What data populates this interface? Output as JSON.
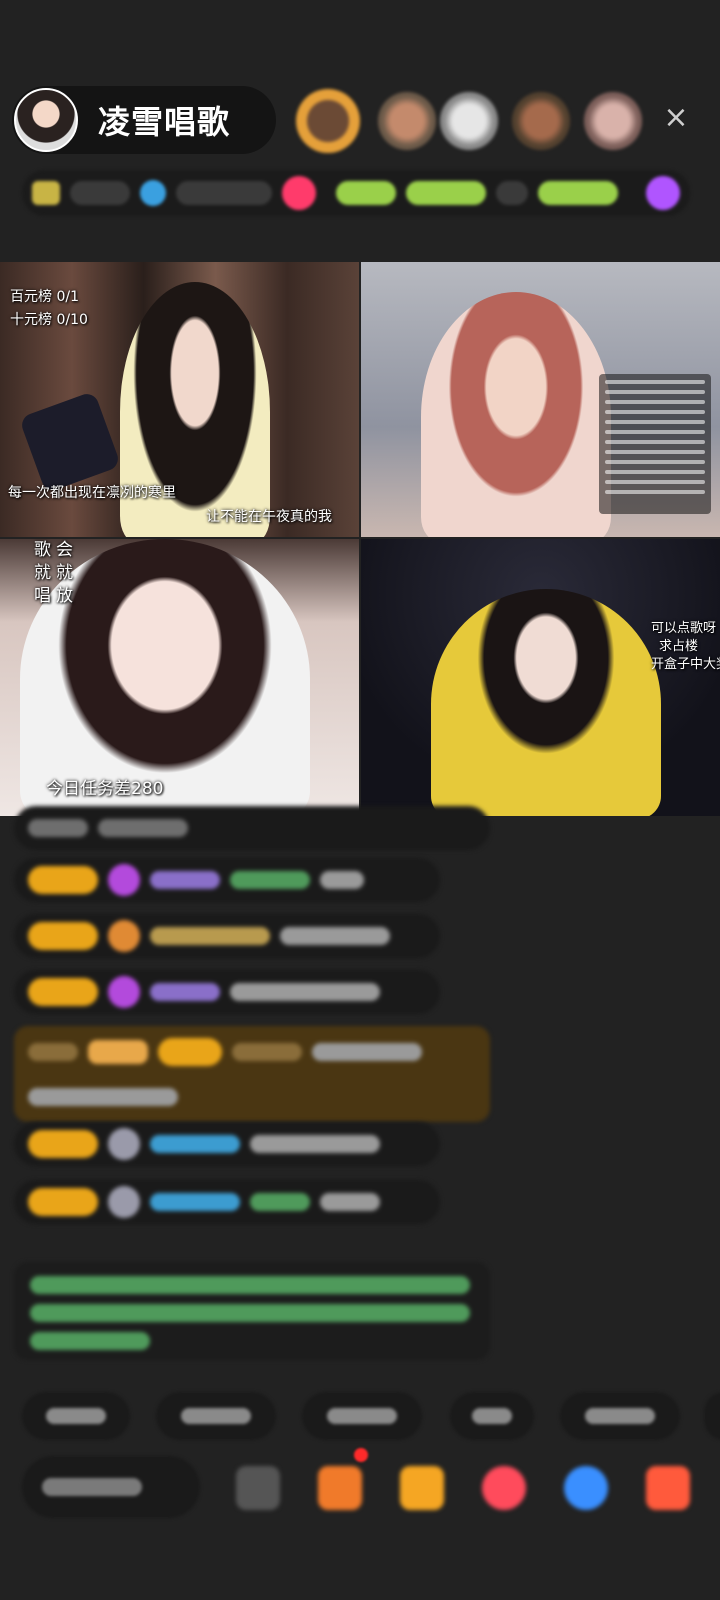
{
  "header": {
    "host_name": "凌雪唱歌",
    "close_icon": "×"
  },
  "video_tiles": {
    "tile1": {
      "rank_hundred": "百元榜 0/1",
      "rank_ten": "十元榜 0/10",
      "subtitle_1": "每一次都出现在凛冽的寒里",
      "subtitle_2": "让不能在午夜真的我"
    },
    "tile3": {
      "vertical_1": "歌就唱",
      "vertical_2": "会就放",
      "task_text": "今日任务差280"
    },
    "tile4": {
      "request_1": "可以点歌呀",
      "request_2": "求占楼",
      "request_3": "开盒子中大奖"
    }
  },
  "colors": {
    "badge_gold": "#e9a519",
    "gift_box": "#4a3612",
    "accent_red": "#ff2a2a"
  }
}
